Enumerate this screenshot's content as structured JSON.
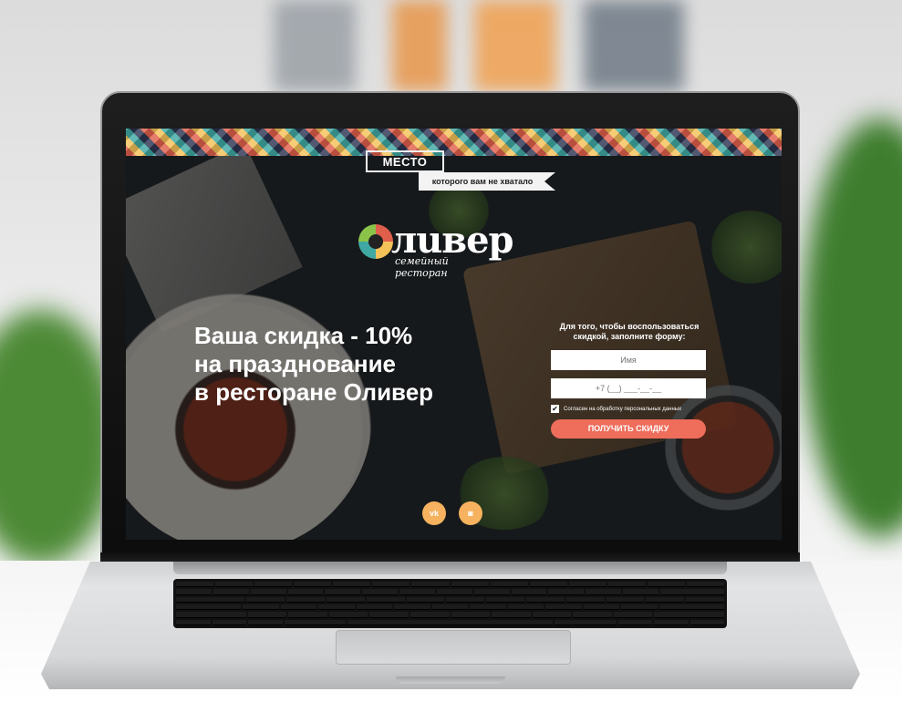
{
  "site": {
    "badge_top": "МЕСТО",
    "badge_ribbon": "которого вам не хватало",
    "logo_word": "лuвер",
    "logo_subtitle": "семейный ресторан",
    "headline": [
      "Ваша скидка - 10%",
      "на празднование",
      "в ресторане Оливер"
    ],
    "form": {
      "intro": [
        "Для того, чтобы воспользоваться",
        "скидкой, заполните форму:"
      ],
      "name_placeholder": "Имя",
      "phone_placeholder": "+7 (__) ___-__-__",
      "consent_label": "Согласен на обработку персональных данных",
      "consent_checked": true,
      "submit_label": "ПОЛУЧИТЬ СКИДКУ"
    },
    "social": [
      {
        "name": "vk-icon",
        "glyph": "vk"
      },
      {
        "name": "instagram-icon",
        "glyph": "◙"
      }
    ],
    "colors": {
      "accent": "#ee6d5b",
      "social": "#f6b25e",
      "pattern": [
        "#e05f4b",
        "#f4c258",
        "#3fa8a2",
        "#2c3452"
      ]
    }
  }
}
